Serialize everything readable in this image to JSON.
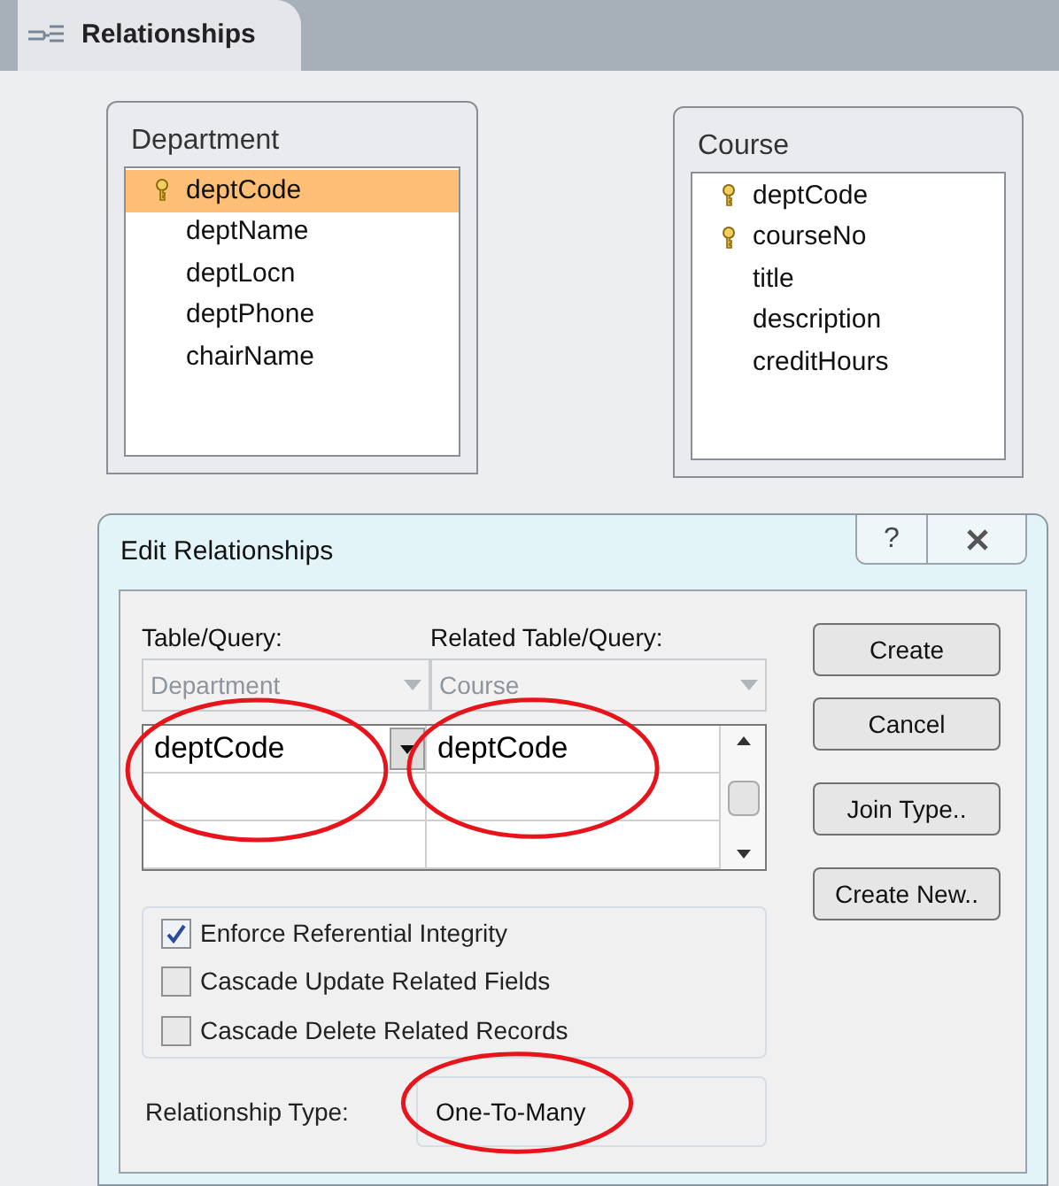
{
  "tab": {
    "label": "Relationships",
    "selected": true
  },
  "tables": [
    {
      "title": "Department",
      "fields": [
        {
          "name": "deptCode",
          "key": true,
          "selected": true
        },
        {
          "name": "deptName",
          "key": false,
          "selected": false
        },
        {
          "name": "deptLocn",
          "key": false,
          "selected": false
        },
        {
          "name": "deptPhone",
          "key": false,
          "selected": false
        },
        {
          "name": "chairName",
          "key": false,
          "selected": false
        }
      ]
    },
    {
      "title": "Course",
      "fields": [
        {
          "name": "deptCode",
          "key": true,
          "selected": false
        },
        {
          "name": "courseNo",
          "key": true,
          "selected": false
        },
        {
          "name": "title",
          "key": false,
          "selected": false
        },
        {
          "name": "description",
          "key": false,
          "selected": false
        },
        {
          "name": "creditHours",
          "key": false,
          "selected": false
        }
      ]
    }
  ],
  "dialog": {
    "title": "Edit Relationships",
    "help_button": "?",
    "table_query": {
      "label": "Table/Query:",
      "value": "Department",
      "disabled": true
    },
    "related_table_query": {
      "label": "Related Table/Query:",
      "value": "Course",
      "disabled": true
    },
    "field_rows": [
      {
        "field": "deptCode",
        "related_field": "deptCode"
      }
    ],
    "buttons": [
      "Create",
      "Cancel",
      "Join Type..",
      "Create New.."
    ],
    "options": [
      {
        "label": "Enforce Referential Integrity",
        "checked": true
      },
      {
        "label": "Cascade Update Related Fields",
        "checked": false
      },
      {
        "label": "Cascade Delete Related Records",
        "checked": false
      }
    ],
    "relationship_type": {
      "label": "Relationship Type:",
      "value": "One-To-Many"
    }
  }
}
